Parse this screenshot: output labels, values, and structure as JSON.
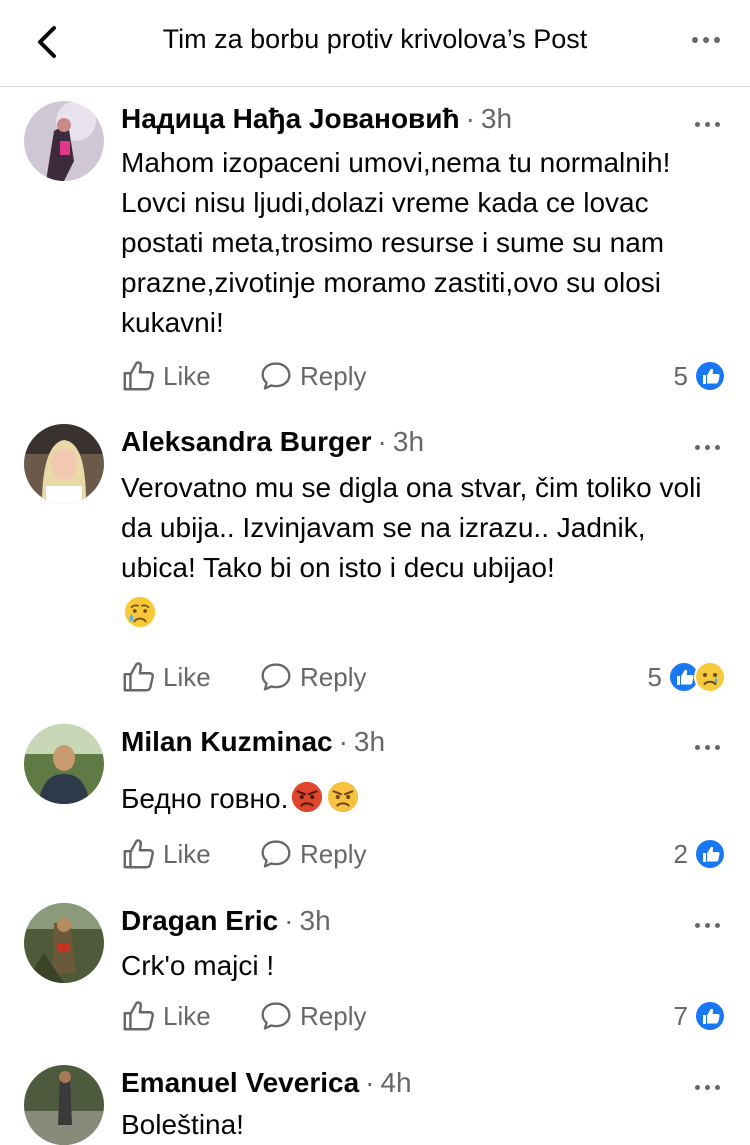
{
  "header": {
    "title": "Tim za borbu protiv krivolova’s Post"
  },
  "actions": {
    "like": "Like",
    "reply": "Reply"
  },
  "comments": [
    {
      "author": "Надица Нађа Јовановић",
      "time": "3h",
      "text": "Mahom izopaceni umovi,nema tu normalnih! Lovci nisu ljudi,dolazi vreme kada ce lovac postati meta,trosimo resurse i sume su nam prazne,zivotinje moramo zastiti,ovo su olosi kukavni!",
      "reaction_count": "5",
      "reactions": [
        "like-icon"
      ]
    },
    {
      "author": "Aleksandra Burger",
      "time": "3h",
      "text": "Verovatno mu se digla ona stvar, čim toliko voli da ubija.. Izvinjavam se na izrazu.. Jadnik, ubica! Tako bi on isto i decu ubijao!",
      "text_emoji": [
        "crying-face-emoji"
      ],
      "reaction_count": "5",
      "reactions": [
        "like-icon",
        "sad-icon"
      ]
    },
    {
      "author": "Milan Kuzminac",
      "time": "3h",
      "text": "Бедно говно.",
      "text_emoji": [
        "pouting-face-emoji",
        "angry-face-emoji"
      ],
      "reaction_count": "2",
      "reactions": [
        "like-icon"
      ]
    },
    {
      "author": "Dragan Eric",
      "time": "3h",
      "text": "Crk'o majci !",
      "reaction_count": "7",
      "reactions": [
        "like-icon"
      ]
    },
    {
      "author": "Emanuel Veverica",
      "time": "4h",
      "text": "Boleština!"
    }
  ],
  "colors": {
    "accent": "#1877f2",
    "secondary_text": "#65676b",
    "divider": "#dcdde1"
  }
}
